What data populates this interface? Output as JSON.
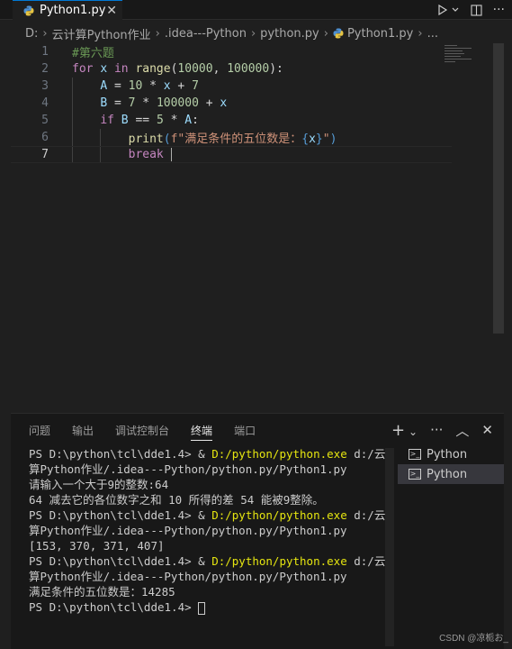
{
  "tab": {
    "title": "Python1.py",
    "close": "✕"
  },
  "toolbar": {
    "run_icon": "play-icon",
    "split_icon": "split-editor-icon",
    "more": "···"
  },
  "breadcrumb": [
    "D:",
    "云计算Python作业",
    ".idea---Python",
    "python.py",
    "Python1.py",
    "..."
  ],
  "editor": {
    "lines": [
      {
        "n": "1"
      },
      {
        "n": "2"
      },
      {
        "n": "3"
      },
      {
        "n": "4"
      },
      {
        "n": "5"
      },
      {
        "n": "6"
      },
      {
        "n": "7"
      }
    ],
    "code": {
      "l1_comment": "#第六题",
      "l2_for": "for",
      "l2_x": "x",
      "l2_in": "in",
      "l2_range": "range",
      "l2_open": "(",
      "l2_a": "10000",
      "l2_comma": ", ",
      "l2_b": "100000",
      "l2_close": "):",
      "l3_A": "A",
      "l3_eq": " = ",
      "l3_10": "10",
      "l3_mul": " * ",
      "l3_x": "x",
      "l3_plus": " + ",
      "l3_7": "7",
      "l4_B": "B",
      "l4_eq": " = ",
      "l4_7": "7",
      "l4_mul": " * ",
      "l4_100000": "100000",
      "l4_plus": " + ",
      "l4_x": "x",
      "l5_if": "if",
      "l5_B": "B",
      "l5_eqeq": " == ",
      "l5_5": "5",
      "l5_mul": " * ",
      "l5_A": "A",
      "l5_colon": ":",
      "l6_print": "print",
      "l6_open": "(",
      "l6_f": "f\"满足条件的五位数是：",
      "l6_brace_open": "{",
      "l6_x": "x",
      "l6_brace_close": "}",
      "l6_end": "\"",
      "l6_close": ")",
      "l7_break": "break"
    }
  },
  "panel": {
    "tabs": [
      "问题",
      "输出",
      "调试控制台",
      "终端",
      "端口"
    ],
    "active_tab": "终端",
    "actions": {
      "add": "+",
      "chevron": "⌄",
      "more": "···",
      "maximize": "︿",
      "close": "✕"
    },
    "terminal_list": [
      "Python",
      "Python"
    ]
  },
  "terminal": {
    "prompt1": "PS D:\\python\\tcl\\dde1.4> & ",
    "exe": "D:/python/python.exe",
    "arg1": " d:/云计",
    "cont1": "算Python作业/.idea---Python/python.py/Python1.py",
    "out1": "请输入一个大于9的整数:64",
    "out2": "64 减去它的各位数字之和 10 所得的差 54 能被9整除。",
    "prompt2": "PS D:\\python\\tcl\\dde1.4> & ",
    "arg2": " d:/云计",
    "cont2": "算Python作业/.idea---Python/python.py/Python1.py",
    "out3": "[153, 370, 371, 407]",
    "prompt3": "PS D:\\python\\tcl\\dde1.4> & ",
    "arg3": " d:/云计",
    "cont3": "算Python作业/.idea---Python/python.py/Python1.py",
    "out4": "满足条件的五位数是：14285",
    "prompt4": "PS D:\\python\\tcl\\dde1.4> "
  },
  "watermark": "CSDN @凉栀お_"
}
